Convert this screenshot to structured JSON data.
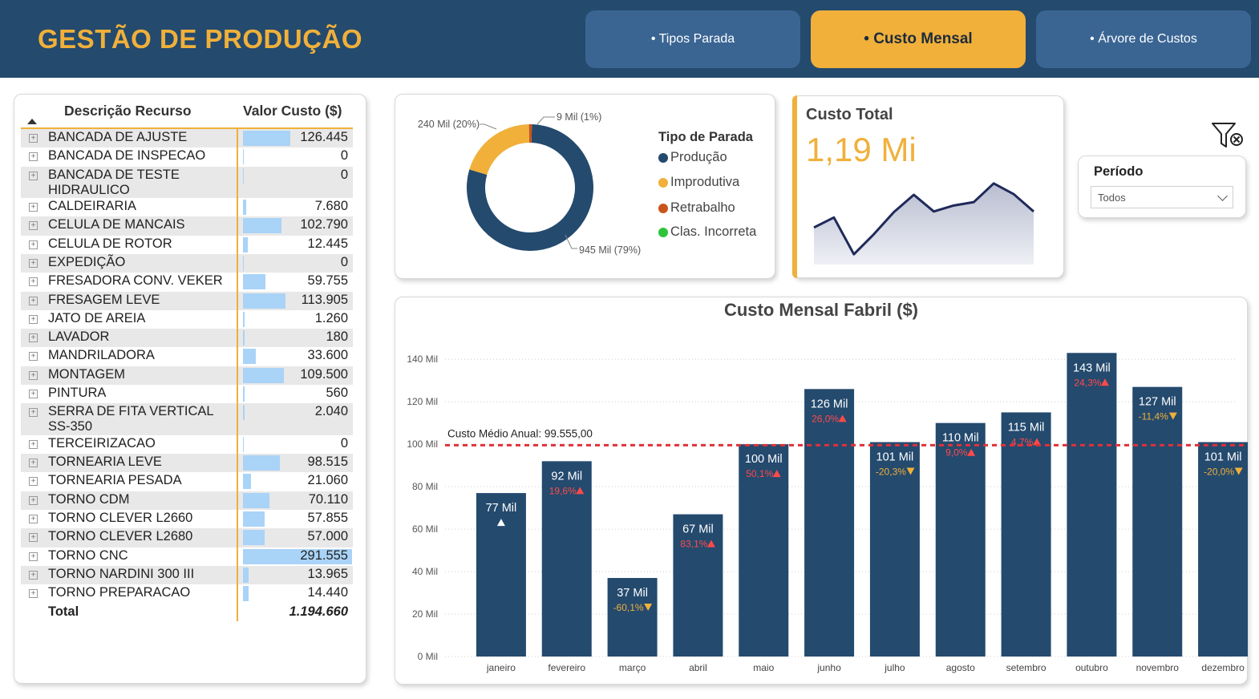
{
  "header": {
    "title": "GESTÃO DE PRODUÇÃO",
    "nav": [
      {
        "label": "• Tipos Parada",
        "active": false
      },
      {
        "label": "• Custo Mensal",
        "active": true
      },
      {
        "label": "• Árvore de Custos",
        "active": false
      }
    ]
  },
  "colors": {
    "navy": "#244a6e",
    "accent": "#f0b03a",
    "bar": "#244a6e",
    "red": "#e8343a",
    "tablebar": "#a9d3f7"
  },
  "table": {
    "col_name": "Descrição Recurso",
    "col_value": "Valor Custo ($)",
    "rows": [
      {
        "name": "BANCADA DE AJUSTE",
        "value": "126.445",
        "num": 126445
      },
      {
        "name": "BANCADA DE INSPECAO",
        "value": "0",
        "num": 0
      },
      {
        "name": "BANCADA DE TESTE HIDRAULICO",
        "value": "0",
        "num": 0
      },
      {
        "name": "CALDEIRARIA",
        "value": "7.680",
        "num": 7680
      },
      {
        "name": "CELULA DE MANCAIS",
        "value": "102.790",
        "num": 102790
      },
      {
        "name": "CELULA DE ROTOR",
        "value": "12.445",
        "num": 12445
      },
      {
        "name": "EXPEDIÇÃO",
        "value": "0",
        "num": 0
      },
      {
        "name": "FRESADORA CONV. VEKER",
        "value": "59.755",
        "num": 59755
      },
      {
        "name": "FRESAGEM LEVE",
        "value": "113.905",
        "num": 113905
      },
      {
        "name": "JATO DE AREIA",
        "value": "1.260",
        "num": 1260
      },
      {
        "name": "LAVADOR",
        "value": "180",
        "num": 180
      },
      {
        "name": "MANDRILADORA",
        "value": "33.600",
        "num": 33600
      },
      {
        "name": "MONTAGEM",
        "value": "109.500",
        "num": 109500
      },
      {
        "name": "PINTURA",
        "value": "560",
        "num": 560
      },
      {
        "name": "SERRA DE FITA VERTICAL SS-350",
        "value": "2.040",
        "num": 2040
      },
      {
        "name": "TERCEIRIZACAO",
        "value": "0",
        "num": 0
      },
      {
        "name": "TORNEARIA LEVE",
        "value": "98.515",
        "num": 98515
      },
      {
        "name": "TORNEARIA PESADA",
        "value": "21.060",
        "num": 21060
      },
      {
        "name": "TORNO CDM",
        "value": "70.110",
        "num": 70110
      },
      {
        "name": "TORNO CLEVER L2660",
        "value": "57.855",
        "num": 57855
      },
      {
        "name": "TORNO CLEVER L2680",
        "value": "57.000",
        "num": 57000
      },
      {
        "name": "TORNO CNC",
        "value": "291.555",
        "num": 291555
      },
      {
        "name": "TORNO NARDINI 300 III",
        "value": "13.965",
        "num": 13965
      },
      {
        "name": "TORNO PREPARACAO",
        "value": "14.440",
        "num": 14440
      }
    ],
    "total_label": "Total",
    "total_value": "1.194.660"
  },
  "kpi": {
    "title": "Custo Total",
    "value": "1,19 Mi",
    "sparkline": [
      77,
      92,
      37,
      67,
      100,
      126,
      101,
      110,
      115,
      143,
      127,
      101
    ]
  },
  "slicer": {
    "title": "Período",
    "selected": "Todos"
  },
  "chart_data": [
    {
      "type": "pie",
      "variant": "donut",
      "legend_title": "Tipo de Parada",
      "categories": [
        "Produção",
        "Improdutiva",
        "Retrabalho",
        "Clas. Incorreta"
      ],
      "values": [
        945,
        240,
        9,
        0
      ],
      "labels": [
        "945 Mil (79%)",
        "240 Mil (20%)",
        "9 Mil (1%)",
        ""
      ],
      "colors": [
        "#244a6e",
        "#f0b03a",
        "#c9541b",
        "#2ec43a"
      ]
    },
    {
      "type": "bar",
      "title": "Custo Mensal Fabril ($)",
      "categories": [
        "janeiro",
        "fevereiro",
        "março",
        "abril",
        "maio",
        "junho",
        "julho",
        "agosto",
        "setembro",
        "outubro",
        "novembro",
        "dezembro"
      ],
      "values": [
        77,
        92,
        37,
        67,
        100,
        126,
        101,
        110,
        115,
        143,
        127,
        101
      ],
      "value_labels": [
        "77 Mil",
        "92 Mil",
        "37 Mil",
        "67 Mil",
        "100 Mil",
        "126 Mil",
        "101 Mil",
        "110 Mil",
        "115 Mil",
        "143 Mil",
        "127 Mil",
        "101 Mil"
      ],
      "changes": [
        "",
        "19,6%",
        "-60,1%",
        "83,1%",
        "50,1%",
        "26,0%",
        "-20,3%",
        "9,0%",
        "4,7%",
        "24,3%",
        "-11,4%",
        "-20,0%"
      ],
      "change_dir": [
        "up",
        "up",
        "down",
        "up",
        "up",
        "up",
        "down",
        "up",
        "up",
        "up",
        "down",
        "down"
      ],
      "yticks": [
        "0 Mil",
        "20 Mil",
        "40 Mil",
        "60 Mil",
        "80 Mil",
        "100 Mil",
        "120 Mil",
        "140 Mil"
      ],
      "ylim": [
        0,
        150
      ],
      "reference_line": {
        "label": "Custo Médio Anual: 99.555,00",
        "value": 99.555
      }
    }
  ]
}
